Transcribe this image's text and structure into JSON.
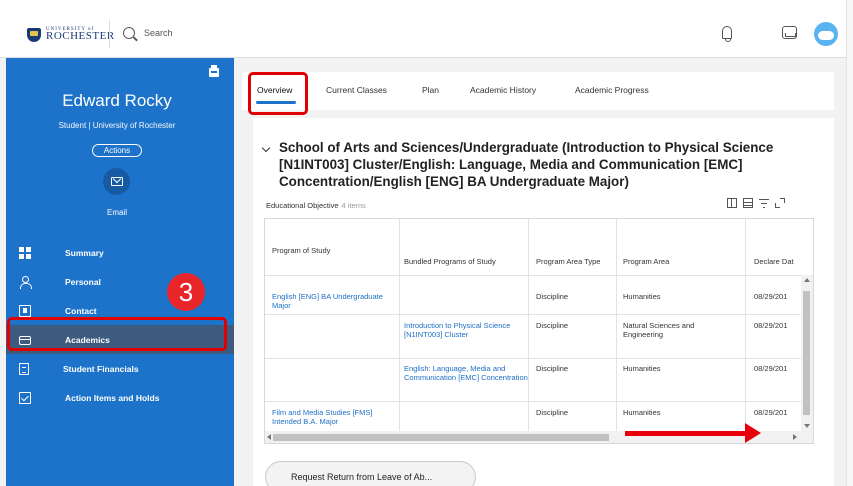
{
  "header": {
    "logo_small": "UNIVERSITY of",
    "logo_main": "ROCHESTER",
    "search_placeholder": "Search",
    "icons": [
      "search-icon",
      "bell-icon",
      "inbox-icon",
      "cloud-avatar-icon"
    ],
    "avatar_color": "#5ab2f0"
  },
  "sidebar": {
    "name": "Edward Rocky",
    "subtitle": "Student | University of Rochester",
    "actions_label": "Actions",
    "email_label": "Email",
    "accent": "#1d73c9",
    "active_bg": "#3d5b7f",
    "items": [
      {
        "label": "Summary",
        "icon": "grid-icon"
      },
      {
        "label": "Personal",
        "icon": "person-icon"
      },
      {
        "label": "Contact",
        "icon": "contact-icon"
      },
      {
        "label": "Academics",
        "icon": "card-icon",
        "active": true
      },
      {
        "label": "Student Financials",
        "icon": "document-icon"
      },
      {
        "label": "Action Items and Holds",
        "icon": "checkbox-icon"
      }
    ]
  },
  "annotation": {
    "step_number": "3",
    "color": "#e00000"
  },
  "tabs": [
    {
      "label": "Overview",
      "active": true
    },
    {
      "label": "Current Classes"
    },
    {
      "label": "Plan"
    },
    {
      "label": "Academic History"
    },
    {
      "label": "Academic Progress"
    }
  ],
  "section": {
    "title": "School of Arts and Sciences/Undergraduate (Introduction to Physical Science [N1INT003] Cluster/English: Language, Media and Communication [EMC] Concentration/English [ENG] BA Undergraduate Major)",
    "table_title": "Educational Objective",
    "item_count": "4 items"
  },
  "table": {
    "columns": [
      "Program of Study",
      "Bundled Programs of Study",
      "Program Area Type",
      "Program Area",
      "Declare Dat"
    ],
    "rows": [
      {
        "program": "English [ENG] BA Undergraduate Major",
        "bundled": "",
        "area_type": "Discipline",
        "area": "Humanities",
        "declare": "08/29/201"
      },
      {
        "program": "",
        "bundled": "Introduction to Physical Science [N1INT003] Cluster",
        "area_type": "Discipline",
        "area": "Natural Sciences and Engineering",
        "declare": "08/29/201"
      },
      {
        "program": "",
        "bundled": "English: Language, Media and Communication [EMC] Concentration",
        "area_type": "Discipline",
        "area": "Humanities",
        "declare": "08/29/201"
      },
      {
        "program": "Film and Media Studies [FMS] Intended B.A. Major",
        "bundled": "",
        "area_type": "Discipline",
        "area": "Humanities",
        "declare": "08/29/201"
      }
    ]
  },
  "footer_button": "Request Return from Leave of Ab..."
}
